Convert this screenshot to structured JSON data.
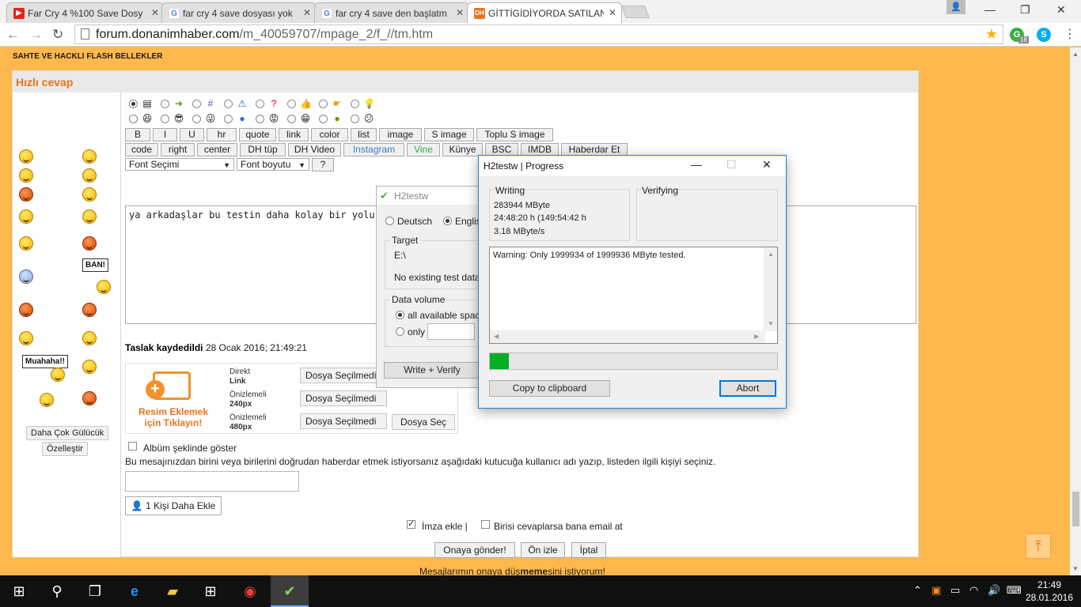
{
  "browser": {
    "tabs": [
      {
        "title": "Far Cry 4 %100 Save Dosy"
      },
      {
        "title": "far cry 4 save dosyası yok"
      },
      {
        "title": "far cry 4 save den başlatm"
      },
      {
        "title": "GİTTİGİDİYORDA SATILAN"
      }
    ],
    "active_tab_badge": "DH",
    "url_host": "forum.donanimhaber.com",
    "url_path": "/m_40059707/mpage_2/f_//tm.htm",
    "ext_badge": "18"
  },
  "page": {
    "sahte_title": "SAHTE VE HACKLI FLASH BELLEKLER",
    "hizli_cevap": "Hızlı cevap",
    "sign_ban": "BAN!",
    "sign_muahaha": "Muahaha!!",
    "more_smileys": "Daha Çok Gülücük",
    "customize": "Özelleştir",
    "editor_row1": [
      "B",
      "I",
      "U",
      "hr",
      "quote",
      "link",
      "color",
      "list",
      "image",
      "S image",
      "Toplu S image"
    ],
    "editor_row2": [
      "code",
      "right",
      "center",
      "DH tüp",
      "DH Video",
      "Instagram",
      "Vine",
      "Künye",
      "BSC",
      "IMDB",
      "Haberdar Et"
    ],
    "font_select": "Font Seçimi",
    "font_size": "Font boyutu",
    "help_btn": "?",
    "message_text": "ya arkadaşlar bu testin daha kolay bir yolu yokmudur",
    "taslak_label": "Taslak kaydedildi",
    "taslak_date": "28 Ocak 2016; 21:49:21",
    "upload_text": "Resim Eklemek için Tıklayın!",
    "upload_rows": [
      {
        "label": "Direkt",
        "value": "Link",
        "btn": "Dosya Seçilmedi"
      },
      {
        "label": "Önizlemeli",
        "value": "240px",
        "btn": "Dosya Seçilmedi"
      },
      {
        "label": "Önizlemeli",
        "value": "480px",
        "btn": "Dosya Seçilmedi"
      }
    ],
    "file_select": "Dosya Seç",
    "album_label": "Albüm şeklinde göster",
    "haberdar_text": "Bu mesajınızdan birini veya birilerini doğrudan haberdar etmek istiyorsanız aşağıdaki kutucuğa kullanıcı adı yazıp, listeden ilgili kişiyi seçiniz.",
    "add_person": "1 Kişi Daha Ekle",
    "imza_label": "İmza ekle |",
    "email_label": "Birisi cevaplarsa bana email at",
    "submit": "Onaya gönder!",
    "preview": "Ön izle",
    "cancel": "İptal",
    "footer_pre": "Mesajlarımın onaya düş",
    "footer_bold": "meme",
    "footer_post": "sini istiyorum!"
  },
  "h2testw": {
    "title": "H2testw",
    "lang_de": "Deutsch",
    "lang_en": "English",
    "target_label": "Target",
    "target_value": "E:\\",
    "no_test_data": "No existing test data.",
    "data_volume_label": "Data volume",
    "all_space": "all available space",
    "only": "only",
    "write_verify": "Write + Verify"
  },
  "progress": {
    "title": "H2testw | Progress",
    "writing_label": "Writing",
    "writing_mb": "283944 MByte",
    "writing_time": "24:48:20 h (149:54:42 h",
    "writing_speed": "3.18 MByte/s",
    "verifying_label": "Verifying",
    "log_text": "Warning: Only 1999934 of 1999936 MByte tested.",
    "progress_fraction": 0.066,
    "copy_btn": "Copy to clipboard",
    "abort_btn": "Abort"
  },
  "taskbar": {
    "time": "21:49",
    "date": "28.01.2016"
  },
  "colors": {
    "page_bg": "#ffb84d",
    "accent_orange": "#e8731b",
    "progress_green": "#06b025"
  }
}
